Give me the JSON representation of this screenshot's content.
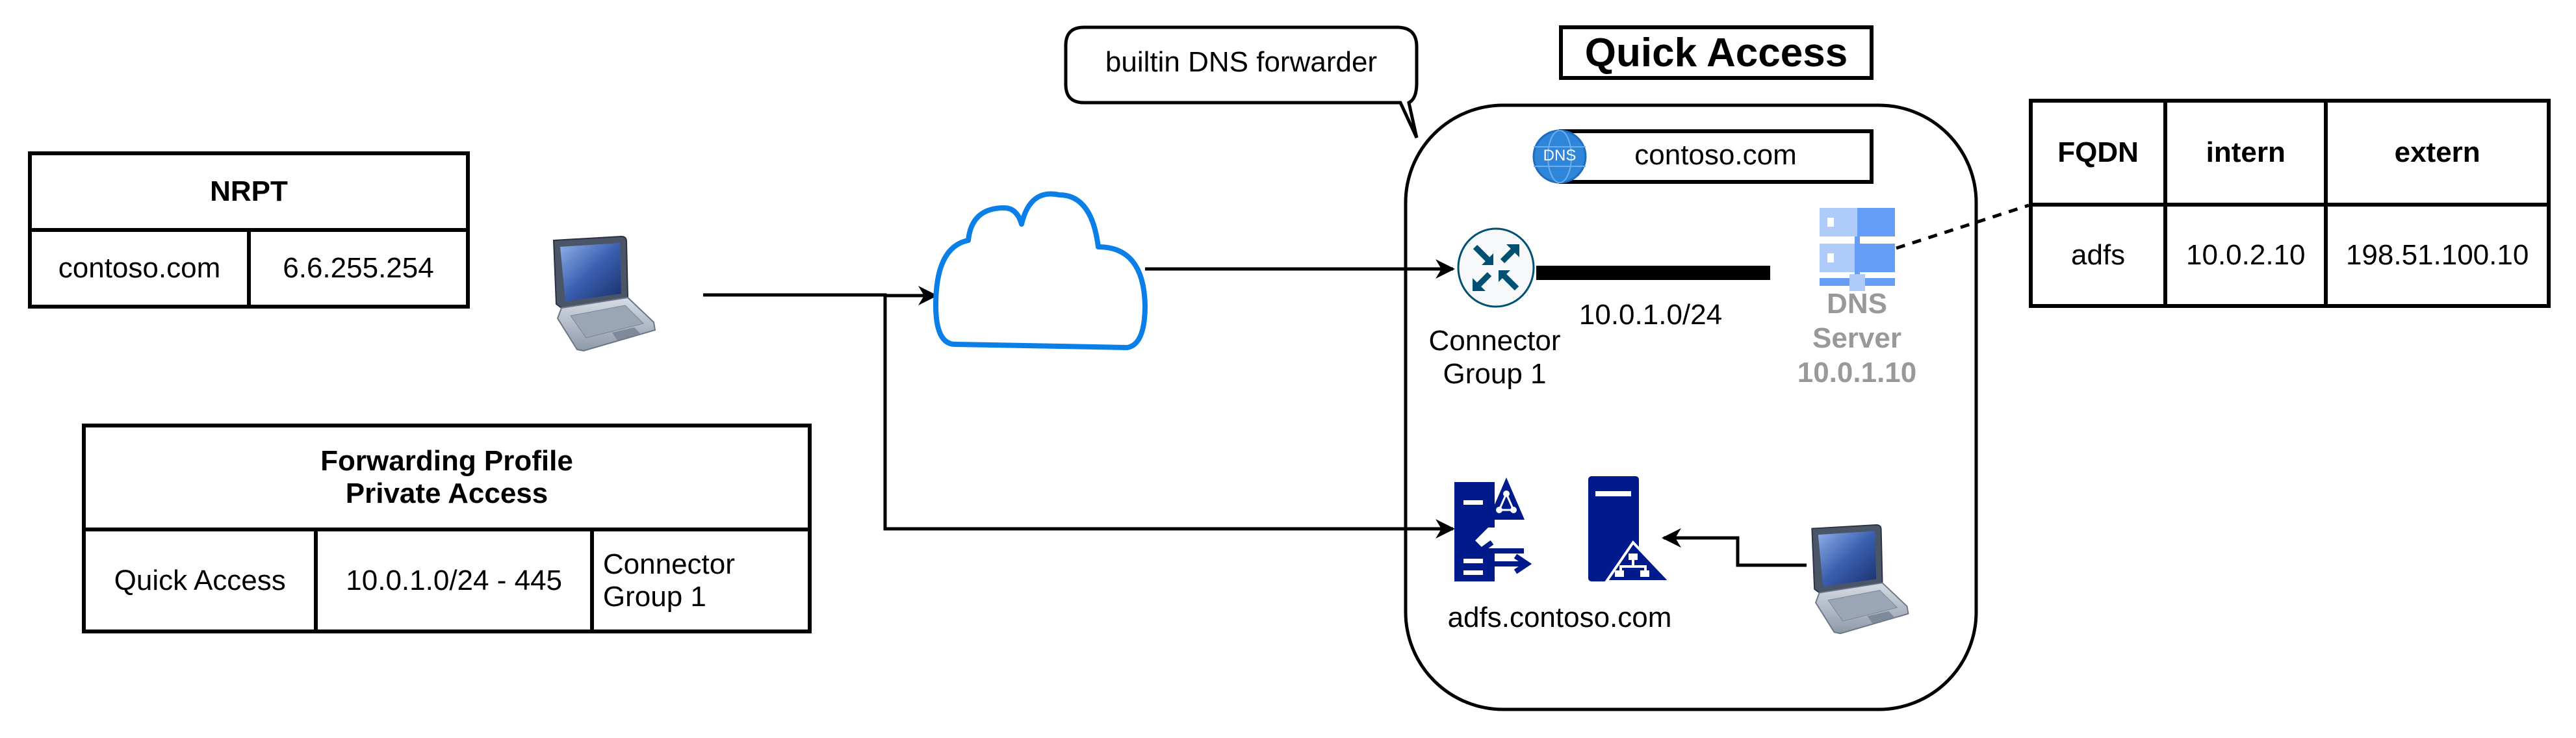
{
  "nrpt": {
    "title": "NRPT",
    "rows": [
      {
        "namespace": "contoso.com",
        "dns_server": "6.6.255.254"
      }
    ]
  },
  "forwarding_profile": {
    "title_line1": "Forwarding Profile",
    "title_line2": "Private Access",
    "rows": [
      {
        "type": "Quick Access",
        "destination": "10.0.1.0/24 - 445",
        "connector_line1": "Connector",
        "connector_line2": "Group 1"
      }
    ]
  },
  "callout": {
    "text": "builtin DNS forwarder"
  },
  "quick_access": {
    "title": "Quick Access",
    "dns_badge": "DNS",
    "dns_suffix": "contoso.com",
    "connector_label_line1": "Connector",
    "connector_label_line2": "Group 1",
    "subnet": "10.0.1.0/24",
    "dns_server_line1": "DNS",
    "dns_server_line2": "Server",
    "dns_server_ip": "10.0.1.10",
    "adfs_label": "adfs.contoso.com"
  },
  "fqdn_table": {
    "headers": [
      "FQDN",
      "intern",
      "extern"
    ],
    "rows": [
      [
        "adfs",
        "10.0.2.10",
        "198.51.100.10"
      ]
    ]
  },
  "colors": {
    "cloud_stroke": "#0a7fe8",
    "router_arrows": "#005073",
    "server_dark": "#001a8c",
    "server_light": "#aecbfa",
    "server_mid": "#669df6",
    "dns_server_text": "#999999",
    "dns_globe": "#2f86d8"
  }
}
